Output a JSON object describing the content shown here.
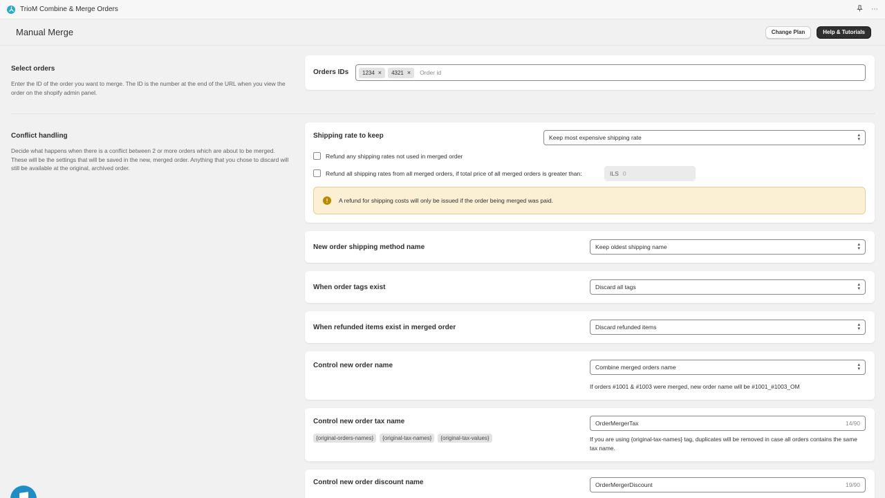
{
  "app": {
    "title": "TrioM Combine & Merge Orders",
    "pin_icon": "pin-icon",
    "more_icon": "more-icon"
  },
  "header": {
    "title": "Manual Merge",
    "change_plan": "Change Plan",
    "help": "Help & Tutorials"
  },
  "select_orders": {
    "title": "Select orders",
    "description": "Enter the ID of the order you want to merge. The ID is the number at the end of the URL when you view the order on the shopify admin panel.",
    "label": "Orders IDs",
    "tags": [
      "1234",
      "4321"
    ],
    "placeholder": "Order id"
  },
  "conflict": {
    "title": "Conflict handling",
    "description": "Decide what happens when there is a conflict between 2 or more orders which are about to be merged. These will be the settings that will be saved in the new, merged order. Anything that you chose to discard will still be available at the original, archived order."
  },
  "shipping_rate": {
    "label": "Shipping rate to keep",
    "value": "Keep most expensive shipping rate",
    "refund_unused": "Refund any shipping rates not used in merged order",
    "refund_all": "Refund all shipping rates from all merged orders, if total price of all merged orders is greater than:",
    "currency": "ILS",
    "threshold": "0",
    "banner": "A refund for shipping costs will only be issued if the order being merged was paid."
  },
  "shipping_method": {
    "label": "New order shipping method name",
    "value": "Keep oldest shipping name"
  },
  "order_tags": {
    "label": "When order tags exist",
    "value": "Discard all tags"
  },
  "refunded_items": {
    "label": "When refunded items exist in merged order",
    "value": "Discard refunded items"
  },
  "order_name": {
    "label": "Control new order name",
    "value": "Combine merged orders name",
    "help": "If orders #1001 & #1003 were merged, new order name will be #1001_#1003_OM"
  },
  "tax_name": {
    "label": "Control new order tax name",
    "chips": [
      "{original-orders-names}",
      "{original-tax-names}",
      "{original-tax-values}"
    ],
    "value": "OrderMergerTax",
    "count": "14/90",
    "help": "If you are using {original-tax-names} tag, duplicates will be removed in case all orders contains the same tax name."
  },
  "discount_name": {
    "label": "Control new order discount name",
    "value": "OrderMergerDiscount",
    "count": "19/90"
  }
}
